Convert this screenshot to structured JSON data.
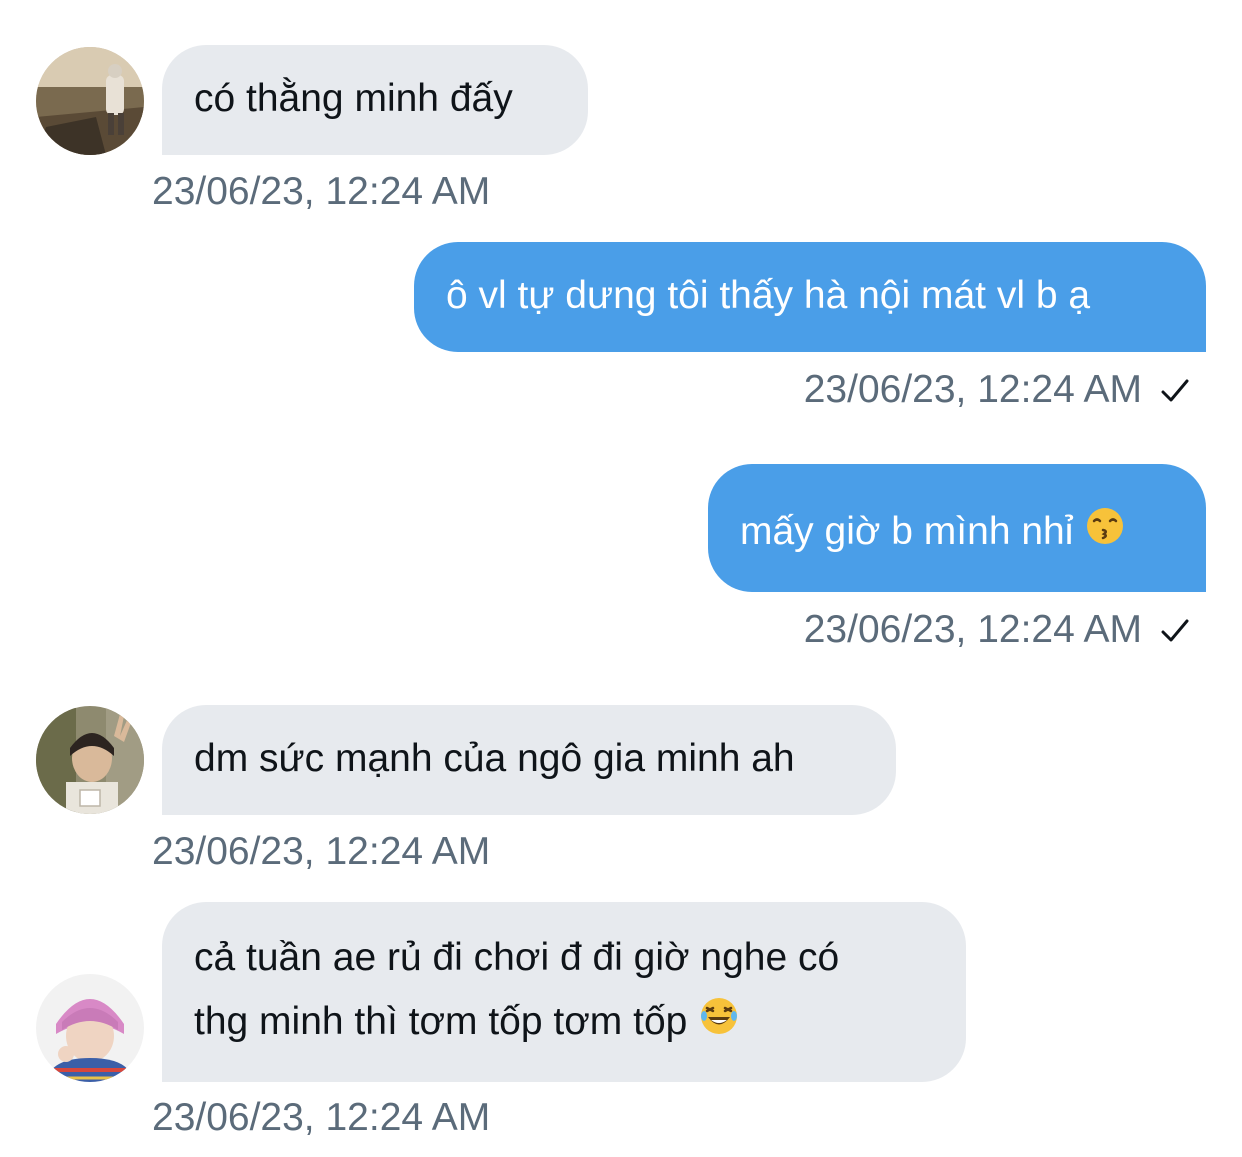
{
  "messages": [
    {
      "sender": "other",
      "avatar": "avatar-landscape-photo",
      "text": "có thằng minh đấy",
      "timestamp": "23/06/23, 12:24 AM"
    },
    {
      "sender": "me",
      "text": "ô vl tự dưng tôi thấy hà nội mát vl b ạ",
      "timestamp": "23/06/23, 12:24 AM",
      "status_icon": "check-icon"
    },
    {
      "sender": "me",
      "text": "mấy giờ b mình nhỉ",
      "emoji": "kissing-face-emoji",
      "timestamp": "23/06/23, 12:24 AM",
      "status_icon": "check-icon"
    },
    {
      "sender": "other",
      "avatar": "avatar-peace-sign-photo",
      "text": "dm sức mạnh của ngô gia minh ah",
      "timestamp": "23/06/23, 12:24 AM"
    },
    {
      "sender": "other",
      "avatar": "avatar-pink-hair-photo",
      "text_lines": [
        "cả tuần ae rủ đi chơi đ đi giờ nghe có",
        "thg minh thì tơm tốp tơm tốp"
      ],
      "emoji": "laughing-tears-emoji",
      "timestamp": "23/06/23, 12:24 AM"
    }
  ],
  "colors": {
    "incoming_bubble": "#e7eaee",
    "outgoing_bubble": "#4a9ee8",
    "timestamp_text": "#5b6b7a"
  }
}
